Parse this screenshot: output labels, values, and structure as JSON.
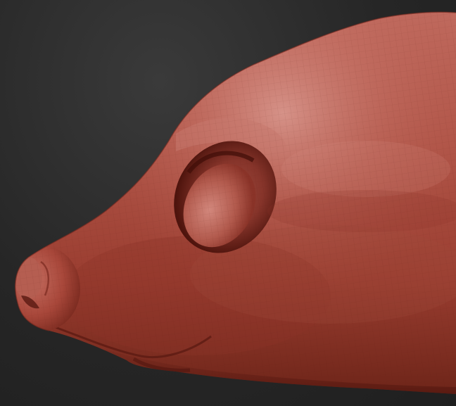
{
  "scene": {
    "subject": "sculpt-head-side-view",
    "material_color": "#a8473a",
    "highlight_color": "#d98a80",
    "shadow_color": "#5e1c14",
    "background_color": "#262626"
  }
}
